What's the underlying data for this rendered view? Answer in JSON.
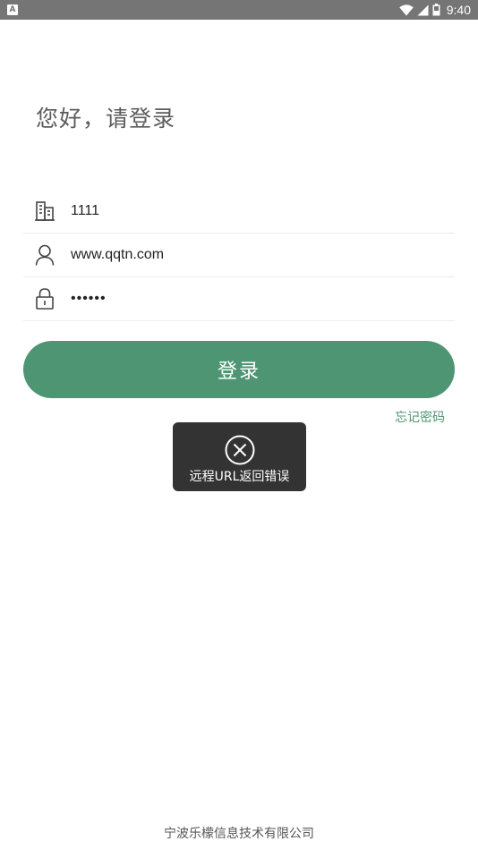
{
  "status_bar": {
    "app_icon_letter": "A",
    "time": "9:40",
    "icons": [
      "wifi-icon",
      "signal-icon",
      "battery-icon"
    ]
  },
  "greeting": "您好，请登录",
  "form": {
    "company": {
      "value": "1111",
      "icon": "building-icon"
    },
    "username": {
      "value": "www.qqtn.com",
      "icon": "person-icon"
    },
    "password": {
      "value": "••••••",
      "icon": "lock-icon"
    }
  },
  "login_button": "登录",
  "forgot_password": "忘记密码",
  "toast": {
    "icon": "error-x-circle-icon",
    "message": "远程URL返回错误"
  },
  "footer": "宁波乐檬信息技术有限公司",
  "colors": {
    "accent": "#4e9673",
    "status_bar": "#757575",
    "toast_bg": "#333333"
  }
}
